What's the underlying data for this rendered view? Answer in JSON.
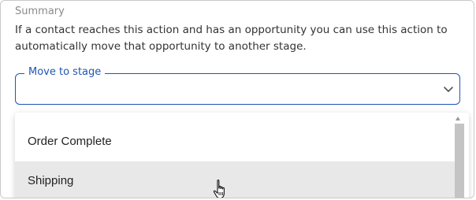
{
  "summary": {
    "label": "Summary",
    "text": "If a contact reaches this action and has an opportunity you can use this action to automatically move that opportunity to another stage."
  },
  "stage_select": {
    "label": "Move to stage",
    "value": "",
    "icon": "chevron-down-icon",
    "accent_color": "#1f55b4"
  },
  "dropdown": {
    "options": [
      {
        "label": "Order Complete",
        "hovered": false
      },
      {
        "label": "Shipping",
        "hovered": true
      }
    ],
    "hover_color": "#e8e8e8"
  }
}
